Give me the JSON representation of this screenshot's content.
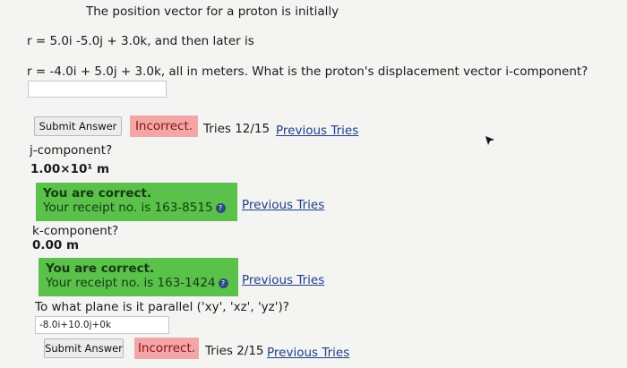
{
  "question": {
    "line1": "The position vector for a proton is initially",
    "line2": "r = 5.0i -5.0j + 3.0k, and then later is",
    "line3": "r = -4.0i + 5.0j + 3.0k, all in meters. What is the proton's displacement vector i-component?",
    "i_answer_value": ""
  },
  "i_part": {
    "submit_label": "Submit Answer",
    "status": "Incorrect.",
    "tries": "Tries 12/15",
    "previous_tries": "Previous Tries"
  },
  "j_part": {
    "label": "j-component?",
    "answer": "1.00×10¹ m",
    "correct_title": "You are correct.",
    "receipt": "Your receipt no. is 163-8515",
    "previous_tries": "Previous Tries"
  },
  "k_part": {
    "label": "k-component?",
    "answer": "0.00 m",
    "correct_title": "You are correct.",
    "receipt": "Your receipt no. is 163-1424",
    "previous_tries": "Previous Tries"
  },
  "plane_part": {
    "question": "To what plane is it parallel ('xy', 'xz', 'yz')?",
    "answer_value": "-8.0i+10.0j+0k",
    "submit_label": "Submit Answer",
    "status": "Incorrect.",
    "tries": "Tries 2/15",
    "previous_tries": "Previous Tries"
  },
  "colors": {
    "incorrect_bg": "#f3a6a6",
    "correct_bg": "#5ac14b",
    "link": "#1d3f8a"
  }
}
